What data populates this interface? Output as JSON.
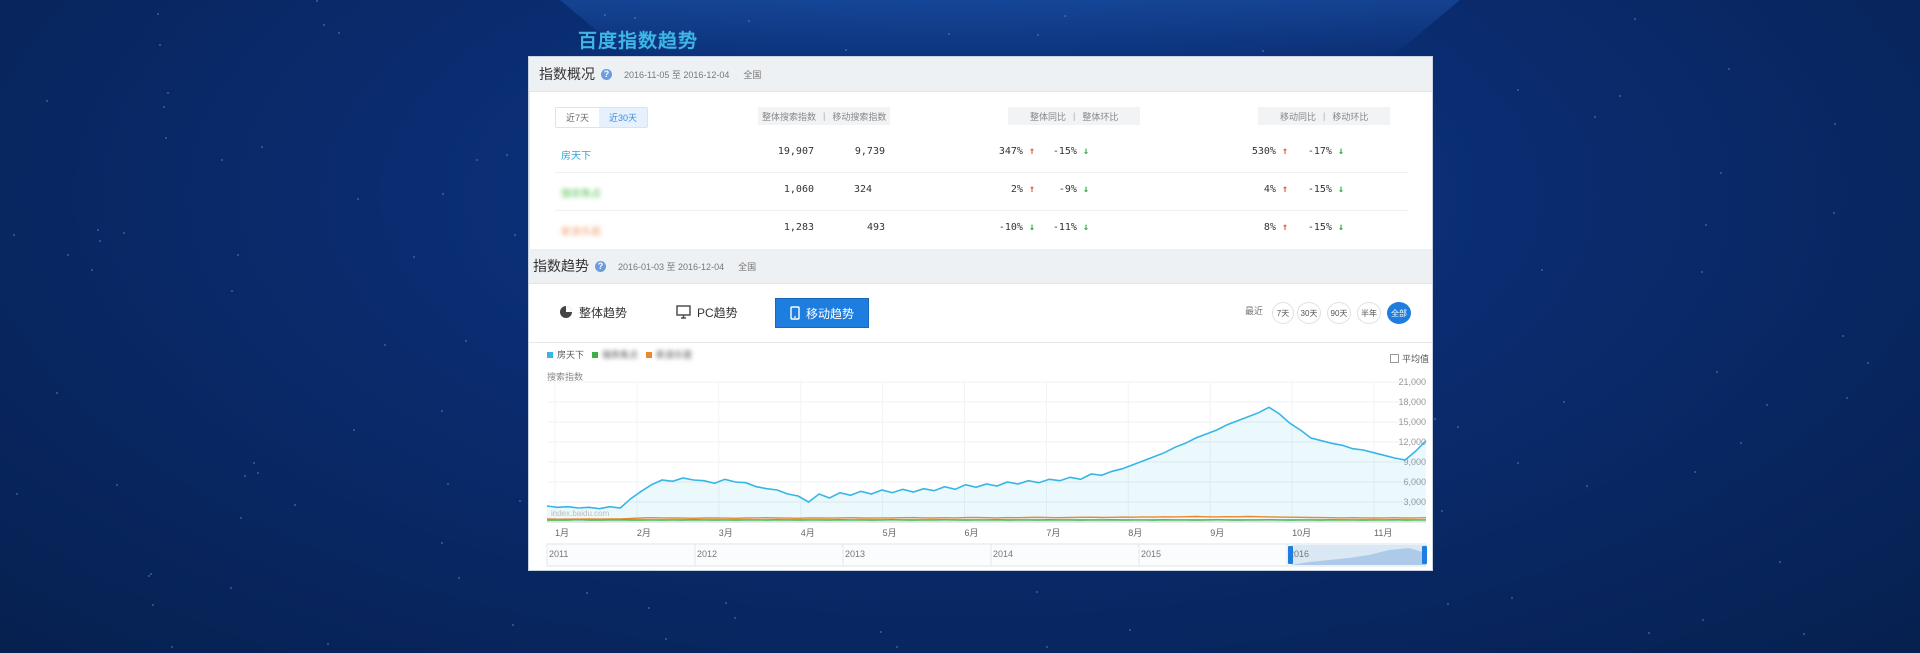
{
  "page_title": "百度指数趋势",
  "overview": {
    "title": "指数概况",
    "date_range": "2016-11-05 至 2016-12-04",
    "region": "全国",
    "period_tabs": [
      {
        "label": "近7天",
        "active": false
      },
      {
        "label": "近30天",
        "active": true
      }
    ],
    "col_search": [
      "整体搜索指数",
      "移动搜索指数"
    ],
    "col_overall": [
      "整体同比",
      "整体环比"
    ],
    "col_mobile": [
      "移动同比",
      "移动环比"
    ],
    "rows": [
      {
        "name": "房天下",
        "color": "#2aa7d8",
        "total": "19,907",
        "mobile": "9,739",
        "yoy": "347%",
        "yoy_dir": "up",
        "mom": "-15%",
        "mom_dir": "down",
        "m_yoy": "530%",
        "m_yoy_dir": "up",
        "m_mom": "-17%",
        "m_mom_dir": "down"
      },
      {
        "name": "搜房焦点",
        "color": "#5ec45a",
        "total": "1,060",
        "mobile": "324",
        "yoy": "2%",
        "yoy_dir": "up",
        "mom": "-9%",
        "mom_dir": "down",
        "m_yoy": "4%",
        "m_yoy_dir": "up",
        "m_mom": "-15%",
        "m_mom_dir": "down"
      },
      {
        "name": "新浪乐居",
        "color": "#f0a070",
        "total": "1,283",
        "mobile": "493",
        "yoy": "-10%",
        "yoy_dir": "down",
        "mom": "-11%",
        "mom_dir": "down",
        "m_yoy": "8%",
        "m_yoy_dir": "up",
        "m_mom": "-15%",
        "m_mom_dir": "down"
      }
    ]
  },
  "trend": {
    "title": "指数趋势",
    "date_range": "2016-01-03 至 2016-12-04",
    "region": "全国",
    "tabs": [
      {
        "label": "整体趋势",
        "icon": "pie-chart-icon",
        "active": false
      },
      {
        "label": "PC趋势",
        "icon": "monitor-icon",
        "active": false
      },
      {
        "label": "移动趋势",
        "icon": "mobile-icon",
        "active": true
      }
    ],
    "recent_label": "最近",
    "range_buttons": [
      {
        "label": "7天",
        "active": false
      },
      {
        "label": "30天",
        "active": false
      },
      {
        "label": "90天",
        "active": false
      },
      {
        "label": "半年",
        "active": false
      },
      {
        "label": "全部",
        "active": true
      }
    ],
    "avg_label": "平均值",
    "legend": [
      {
        "name": "房天下",
        "color": "#37b6e6"
      },
      {
        "name": "搜房焦点",
        "color": "#3cb043"
      },
      {
        "name": "新浪乐居",
        "color": "#e8892d"
      }
    ]
  },
  "chart_data": {
    "type": "line",
    "ylabel": "搜索指数",
    "yticks": [
      "21,000",
      "18,000",
      "15,000",
      "12,000",
      "9,000",
      "6,000",
      "3,000"
    ],
    "ylim": [
      0,
      21000
    ],
    "x_months": [
      "1月",
      "2月",
      "3月",
      "4月",
      "5月",
      "6月",
      "7月",
      "8月",
      "9月",
      "10月",
      "11月"
    ],
    "grid": true,
    "series": [
      {
        "name": "房天下",
        "color": "#37b6e6",
        "values": [
          2400,
          2200,
          2300,
          2100,
          2200,
          2000,
          2300,
          2100,
          3500,
          4600,
          5600,
          6300,
          6100,
          6600,
          6300,
          6200,
          5800,
          6400,
          6000,
          5900,
          5300,
          5000,
          4800,
          4200,
          3900,
          3000,
          4200,
          3600,
          4400,
          4000,
          4600,
          4200,
          4800,
          4400,
          4900,
          4500,
          5000,
          4700,
          5300,
          4900,
          5600,
          5200,
          5700,
          5400,
          6000,
          5700,
          6200,
          5900,
          6400,
          6200,
          6700,
          6400,
          7200,
          7000,
          7600,
          8000,
          8600,
          9200,
          9800,
          10400,
          11200,
          11800,
          12600,
          13200,
          13800,
          14600,
          15200,
          15800,
          16400,
          17200,
          16200,
          14800,
          13800,
          12600,
          12200,
          11800,
          11500,
          11000,
          10800,
          10400,
          10000,
          9600,
          9300,
          10600,
          12200
        ]
      },
      {
        "name": "搜房焦点",
        "color": "#3cb043",
        "values": [
          300,
          300,
          300,
          350,
          300,
          300,
          320,
          330,
          300,
          300,
          320,
          300,
          310,
          300,
          330,
          320,
          300,
          310,
          300,
          320,
          310,
          300,
          330,
          310,
          300,
          320,
          310,
          300,
          330,
          320,
          310,
          300,
          320,
          330,
          310,
          300,
          320,
          310,
          330,
          320,
          300,
          310,
          320,
          330,
          300,
          310,
          320,
          300,
          330,
          310,
          320,
          300,
          310,
          320,
          330,
          300,
          310,
          320,
          300,
          330,
          320,
          310,
          300,
          320,
          330,
          310,
          300,
          320,
          310,
          330,
          320,
          300,
          310,
          320,
          300,
          330,
          310,
          320,
          300,
          310,
          320,
          330,
          300,
          310,
          320
        ]
      },
      {
        "name": "新浪乐居",
        "color": "#e8892d",
        "values": [
          450,
          420,
          440,
          430,
          460,
          440,
          450,
          470,
          520,
          600,
          650,
          620,
          600,
          580,
          560,
          600,
          620,
          580,
          560,
          600,
          620,
          640,
          600,
          580,
          560,
          620,
          600,
          580,
          620,
          640,
          600,
          580,
          620,
          600,
          640,
          660,
          620,
          600,
          640,
          620,
          660,
          680,
          640,
          620,
          660,
          640,
          680,
          700,
          660,
          640,
          680,
          700,
          720,
          680,
          700,
          740,
          720,
          760,
          740,
          780,
          760,
          800,
          820,
          780,
          760,
          800,
          780,
          820,
          800,
          760,
          740,
          720,
          700,
          680,
          660,
          640,
          620,
          640,
          620,
          600,
          620,
          640,
          600,
          620,
          640
        ]
      }
    ]
  },
  "timeline": {
    "years": [
      "2011",
      "2012",
      "2013",
      "2014",
      "2015",
      "2016"
    ]
  },
  "watermark": "index.baidu.com"
}
